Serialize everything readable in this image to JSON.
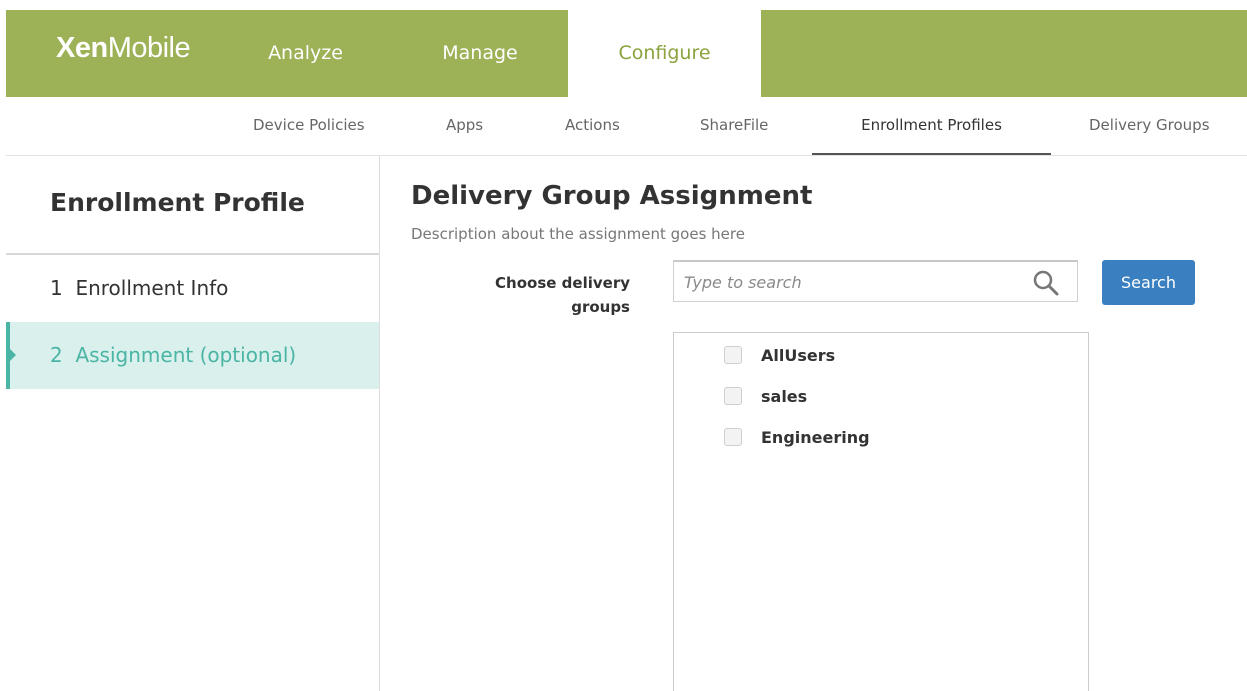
{
  "app": {
    "logo_bold": "Xen",
    "logo_light": "Mobile",
    "brand_color": "#9db156",
    "accent_color": "#4ab5a4",
    "button_color": "#3a80c0"
  },
  "nav": {
    "tabs": [
      {
        "label": "Analyze"
      },
      {
        "label": "Manage"
      },
      {
        "label": "Configure",
        "active": true
      }
    ]
  },
  "subnav": {
    "items": [
      {
        "label": "Device Policies"
      },
      {
        "label": "Apps"
      },
      {
        "label": "Actions"
      },
      {
        "label": "ShareFile"
      },
      {
        "label": "Enrollment Profiles",
        "active": true
      },
      {
        "label": "Delivery Groups"
      }
    ]
  },
  "sidebar": {
    "title": "Enrollment Profile",
    "steps": [
      {
        "number": "1",
        "label": "Enrollment Info",
        "current": false
      },
      {
        "number": "2",
        "label": "Assignment (optional)",
        "current": true
      }
    ]
  },
  "main": {
    "title": "Delivery Group Assignment",
    "description": "Description about the assignment goes here",
    "field_label": "Choose delivery groups",
    "search": {
      "placeholder": "Type to search",
      "value": "",
      "icon": "search-icon"
    },
    "search_button": "Search",
    "groups": [
      {
        "name": "AllUsers",
        "checked": false
      },
      {
        "name": "sales",
        "checked": false
      },
      {
        "name": "Engineering",
        "checked": false
      }
    ]
  }
}
